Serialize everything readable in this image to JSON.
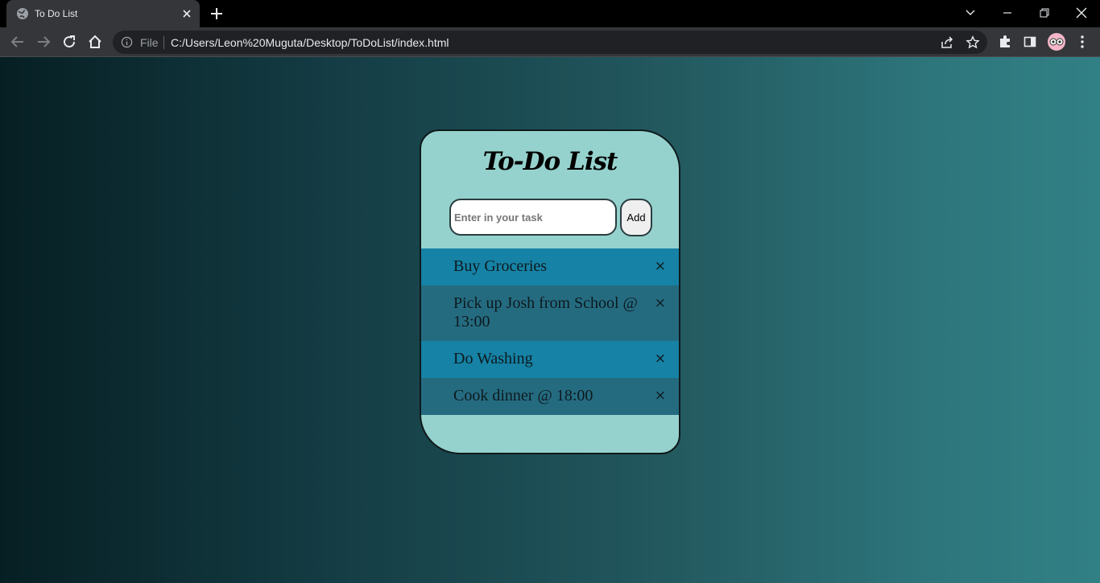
{
  "browser": {
    "tab_title": "To Do List",
    "omnibox": {
      "file_label": "File",
      "url": "C:/Users/Leon%20Muguta/Desktop/ToDoList/index.html"
    }
  },
  "app": {
    "title": "To-Do List",
    "input": {
      "placeholder": "Enter in your task",
      "value": ""
    },
    "add_label": "Add",
    "remove_glyph": "×",
    "tasks": [
      {
        "text": "Buy Groceries"
      },
      {
        "text": "Pick up Josh from School @ 13:00"
      },
      {
        "text": "Do Washing"
      },
      {
        "text": "Cook dinner @ 18:00"
      }
    ]
  },
  "colors": {
    "card_bg": "#96d2cd",
    "task_row_odd": "#1682a5",
    "task_row_even": "#256b80",
    "gradient_left": "#061f23",
    "gradient_right": "#318085"
  }
}
